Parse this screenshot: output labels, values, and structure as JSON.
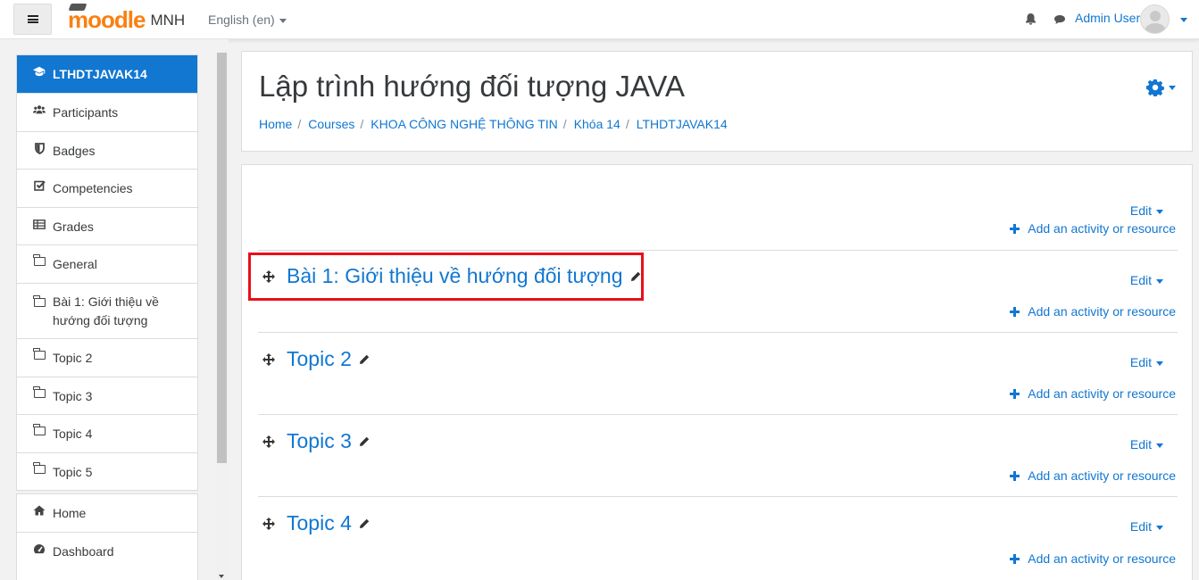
{
  "navbar": {
    "site_logo": "moodle",
    "site_name": "MNH",
    "language": "English (en)",
    "user_name": "Admin User",
    "icons": [
      "menu-icon",
      "bell-icon",
      "chat-icon",
      "avatar"
    ]
  },
  "drawer": {
    "course_items": [
      {
        "label": "LTHDTJAVAK14",
        "icon": "graduation-cap-icon",
        "active": true
      },
      {
        "label": "Participants",
        "icon": "users-icon"
      },
      {
        "label": "Badges",
        "icon": "shield-icon"
      },
      {
        "label": "Competencies",
        "icon": "checkbox-icon"
      },
      {
        "label": "Grades",
        "icon": "table-icon"
      },
      {
        "label": "General",
        "icon": "folder-icon"
      },
      {
        "label": "Bài 1: Giới thiệu về hướng đối tượng",
        "icon": "folder-icon"
      },
      {
        "label": "Topic 2",
        "icon": "folder-icon"
      },
      {
        "label": "Topic 3",
        "icon": "folder-icon"
      },
      {
        "label": "Topic 4",
        "icon": "folder-icon"
      },
      {
        "label": "Topic 5",
        "icon": "folder-icon"
      }
    ],
    "site_items": [
      {
        "label": "Home",
        "icon": "home-icon"
      },
      {
        "label": "Dashboard",
        "icon": "dashboard-icon"
      }
    ]
  },
  "page": {
    "title": "Lập trình hướng đối tượng JAVA",
    "breadcrumb": [
      "Home",
      "Courses",
      "KHOA CÔNG NGHỆ THÔNG TIN",
      "Khóa 14",
      "LTHDTJAVAK14"
    ]
  },
  "sections": [
    {
      "name": "",
      "edit_label": "Edit",
      "add_label": "Add an activity or resource"
    },
    {
      "name": "Bài 1: Giới thiệu về hướng đối tượng",
      "edit_label": "Edit",
      "add_label": "Add an activity or resource",
      "highlighted": true
    },
    {
      "name": "Topic 2",
      "edit_label": "Edit",
      "add_label": "Add an activity or resource"
    },
    {
      "name": "Topic 3",
      "edit_label": "Edit",
      "add_label": "Add an activity or resource"
    },
    {
      "name": "Topic 4",
      "edit_label": "Edit",
      "add_label": "Add an activity or resource"
    }
  ],
  "colors": {
    "accent": "#1177d1",
    "brand_orange": "#f98012",
    "highlight": "#e8101a"
  }
}
